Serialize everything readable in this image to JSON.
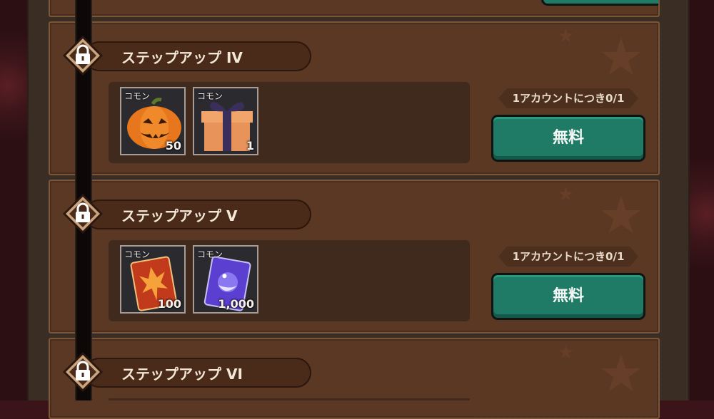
{
  "steps": [
    {
      "title": "ステップアップ IV",
      "items": [
        {
          "rarity": "コモン",
          "qty": "50",
          "icon": "pumpkin-icon"
        },
        {
          "rarity": "コモン",
          "qty": "1",
          "icon": "gift-box-icon"
        }
      ],
      "limit": "1アカウントにつき0/1",
      "button": "無料"
    },
    {
      "title": "ステップアップ V",
      "items": [
        {
          "rarity": "コモン",
          "qty": "100",
          "icon": "red-card-icon"
        },
        {
          "rarity": "コモン",
          "qty": "1,000",
          "icon": "purple-card-icon"
        }
      ],
      "limit": "1アカウントにつき0/1",
      "button": "無料"
    },
    {
      "title": "ステップアップ VI"
    }
  ],
  "colors": {
    "panel": "#5b3823",
    "button": "#1f7a66",
    "title_pill": "#4a2a18"
  }
}
